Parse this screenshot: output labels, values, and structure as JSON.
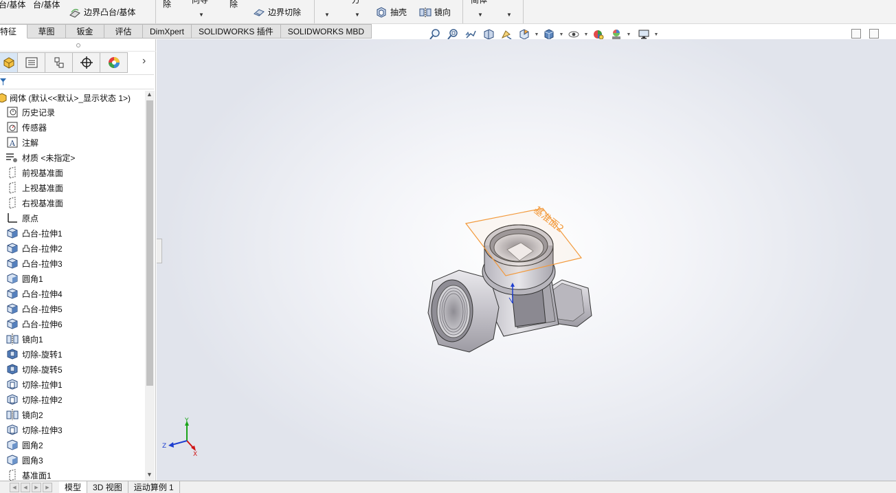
{
  "ribbon": {
    "boss_base_partial": "台/基体",
    "boss_base_partial_2": "台/基体",
    "boundary_boss": "边界凸台/基体",
    "remove_partial": "除",
    "wizard_partial": "向导",
    "remove_partial_2": "除",
    "boundary_cut": "边界切除",
    "draft_partial": "方",
    "shell": "抽壳",
    "mirror": "镜向",
    "body_partial": "简体"
  },
  "command_tabs": [
    "特征",
    "草图",
    "钣金",
    "评估",
    "DimXpert",
    "SOLIDWORKS 插件",
    "SOLIDWORKS MBD"
  ],
  "heads_up_icons": [
    "zoom-to-fit-icon",
    "zoom-area-icon",
    "previous-view-icon",
    "section-view-icon",
    "dynamic-annotation-icon",
    "view-orientation-icon",
    "display-style-icon",
    "hide-show-icon",
    "edit-appearance-icon",
    "apply-scene-icon",
    "view-settings-icon"
  ],
  "feature_tree": {
    "root": "阀体 (默认<<默认>_显示状态 1>)",
    "items": [
      {
        "label": "历史记录",
        "icon": "history-icon"
      },
      {
        "label": "传感器",
        "icon": "sensor-icon"
      },
      {
        "label": "注解",
        "icon": "annotation-icon"
      },
      {
        "label": "材质 <未指定>",
        "icon": "material-icon"
      },
      {
        "label": "前视基准面",
        "icon": "plane-icon"
      },
      {
        "label": "上视基准面",
        "icon": "plane-icon"
      },
      {
        "label": "右视基准面",
        "icon": "plane-icon"
      },
      {
        "label": "原点",
        "icon": "origin-icon"
      },
      {
        "label": "凸台-拉伸1",
        "icon": "extrude-icon"
      },
      {
        "label": "凸台-拉伸2",
        "icon": "extrude-icon"
      },
      {
        "label": "凸台-拉伸3",
        "icon": "extrude-icon"
      },
      {
        "label": "圆角1",
        "icon": "fillet-icon"
      },
      {
        "label": "凸台-拉伸4",
        "icon": "extrude-icon"
      },
      {
        "label": "凸台-拉伸5",
        "icon": "extrude-icon"
      },
      {
        "label": "凸台-拉伸6",
        "icon": "extrude-icon"
      },
      {
        "label": "镜向1",
        "icon": "mirror-icon"
      },
      {
        "label": "切除-旋转1",
        "icon": "revolve-cut-icon"
      },
      {
        "label": "切除-旋转5",
        "icon": "revolve-cut-icon"
      },
      {
        "label": "切除-拉伸1",
        "icon": "extrude-cut-icon"
      },
      {
        "label": "切除-拉伸2",
        "icon": "extrude-cut-icon"
      },
      {
        "label": "镜向2",
        "icon": "mirror-icon"
      },
      {
        "label": "切除-拉伸3",
        "icon": "extrude-cut-icon"
      },
      {
        "label": "圆角2",
        "icon": "fillet-icon"
      },
      {
        "label": "圆角3",
        "icon": "fillet-icon"
      },
      {
        "label": "基准面1",
        "icon": "plane-icon"
      }
    ]
  },
  "viewport": {
    "plane_label": "基准面2",
    "triad": {
      "x": "X",
      "y": "Y",
      "z": "Z"
    },
    "colors": {
      "plane": "#f39a3c",
      "x_axis": "#d01515",
      "y_axis": "#19a319",
      "z_axis": "#1e3fd0"
    }
  },
  "bottom_tabs": [
    "模型",
    "3D 视图",
    "运动算例 1"
  ]
}
